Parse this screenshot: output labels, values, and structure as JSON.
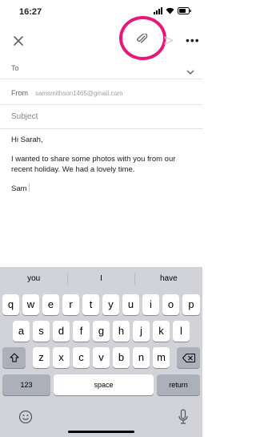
{
  "status_bar": {
    "time": "16:27"
  },
  "toolbar": {
    "close_icon": "close-icon",
    "attach_icon": "paperclip-icon",
    "send_icon": "send-icon",
    "more_icon": "more-vert-icon",
    "more_label": "•••",
    "highlight_color": "#e6187c"
  },
  "compose": {
    "to_label": "To",
    "from_label": "From",
    "from_value": "samsmithson1465@gmail.com",
    "subject_placeholder": "Subject",
    "body": {
      "greeting": "Hi Sarah,",
      "paragraph": "I wanted to share some photos with you from our recent holiday. We had a lovely time.",
      "signature": "Sam"
    }
  },
  "keyboard": {
    "suggestions": [
      "you",
      "I",
      "have"
    ],
    "row1": [
      "q",
      "w",
      "e",
      "r",
      "t",
      "y",
      "u",
      "i",
      "o",
      "p"
    ],
    "row2": [
      "a",
      "s",
      "d",
      "f",
      "g",
      "h",
      "j",
      "k",
      "l"
    ],
    "row3": [
      "z",
      "x",
      "c",
      "v",
      "b",
      "n",
      "m"
    ],
    "numbers_label": "123",
    "space_label": "space",
    "return_label": "return",
    "shift_icon": "shift-icon",
    "backspace_icon": "backspace-icon",
    "emoji_icon": "emoji-icon",
    "mic_icon": "microphone-icon"
  }
}
